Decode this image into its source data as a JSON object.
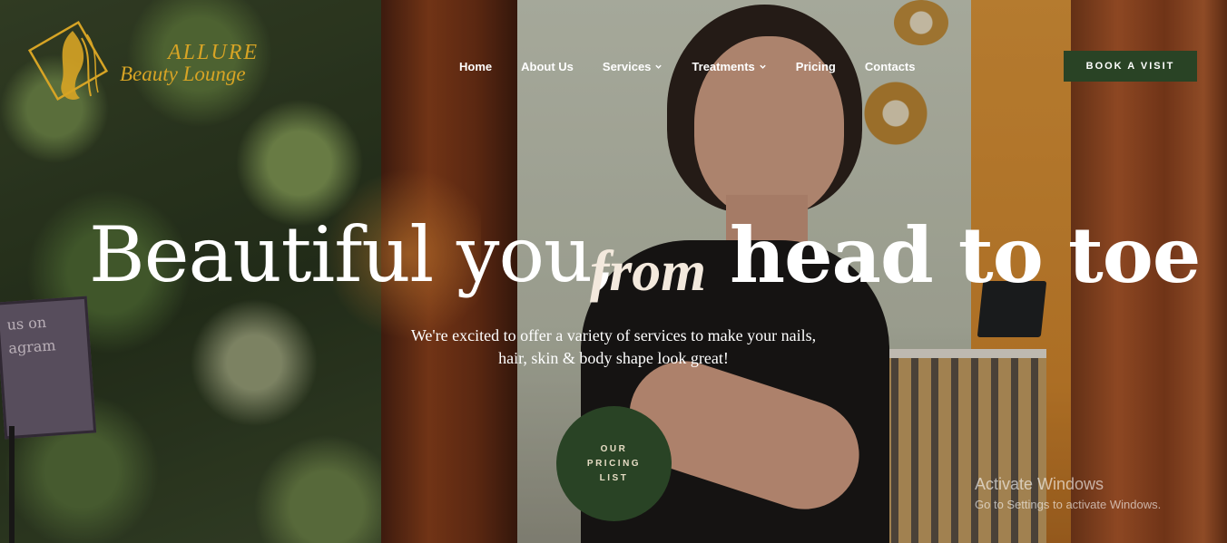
{
  "brand": {
    "title": "ALLURE",
    "subtitle": "Beauty Lounge",
    "color": "#d7a425"
  },
  "nav": {
    "items": [
      {
        "label": "Home",
        "has_dropdown": false
      },
      {
        "label": "About Us",
        "has_dropdown": false
      },
      {
        "label": "Services",
        "has_dropdown": true
      },
      {
        "label": "Treatments",
        "has_dropdown": true
      },
      {
        "label": "Pricing",
        "has_dropdown": false
      },
      {
        "label": "Contacts",
        "has_dropdown": false
      }
    ],
    "cta_label": "BOOK A VISIT"
  },
  "hero": {
    "headline_part1": "Beautiful you,",
    "headline_script": "from",
    "headline_part2": "head to toe",
    "subtext_line1": "We're excited to offer a variety of services to make your nails,",
    "subtext_line2": "hair, skin & body shape look great!",
    "pricing_button": "OUR PRICING LIST"
  },
  "scene": {
    "sign_line1": "us on",
    "sign_line2": "agram"
  },
  "watermark": {
    "title": "Activate Windows",
    "subtitle": "Go to Settings to activate Windows."
  },
  "colors": {
    "accent_green": "#294325",
    "text_white": "#ffffff"
  }
}
